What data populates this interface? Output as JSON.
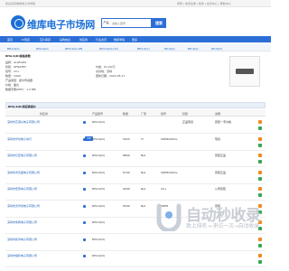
{
  "topbar": {
    "left_text": "欢迎来到维库电子市场网",
    "right_links": [
      "登录",
      "免费注册",
      "我的",
      "会员中心",
      "帮助中心"
    ]
  },
  "header": {
    "logo_text": "维库电子市场网",
    "search_type": "产品",
    "search_placeholder": "请输入型号",
    "search_button": "搜索"
  },
  "navbar": {
    "items": [
      "首页",
      "IC现货",
      "芯片库存",
      "采购信息",
      "供应商",
      "行业资讯",
      "维库学院",
      "更多"
    ]
  },
  "subnav": {
    "items": [
      "BHA-S(0)",
      "RHA-S(0)",
      "RHA-S(0)-ZN",
      "RHA-S(D)-LCC",
      "BHA-S(C)",
      "RH-S(0)",
      "BH-S(0)",
      "RH-S(D)"
    ]
  },
  "detail": {
    "title": "RHA-S(D)规格参数",
    "lines": [
      {
        "label": "品牌",
        "value": "ALLEGRO"
      },
      {
        "label": "封装",
        "value": "QFN/DFN"
      },
      {
        "label": "批号",
        "value": "22+"
      },
      {
        "label": "数量",
        "value": "1000"
      },
      {
        "label": "产品类型",
        "value": "霍尔传感器"
      },
      {
        "label": "价格",
        "value": "面议"
      },
      {
        "label": "数据手册(PDF)",
        "value": "1.2 MB"
      }
    ],
    "right_lines": [
      {
        "label": "价格",
        "value": "¥1.20/元"
      },
      {
        "label": "交货地",
        "value": "深圳"
      },
      {
        "label": "更新日期",
        "value": "2024-05-17"
      }
    ],
    "image_alt": "chip-image"
  },
  "table": {
    "title": "RHA-S(D)供应商报价",
    "headers": [
      "供应商",
      "产品型号",
      "数量",
      "厂家",
      "批号",
      "封装",
      "说明"
    ],
    "rows": [
      {
        "supplier": "深圳市芯源兴电子有限公司",
        "model": "RHA-S(D)",
        "qty": "",
        "brand": "",
        "batch": "",
        "package": "正品现货",
        "note": "原装一手价格",
        "tag": ""
      },
      {
        "supplier": "深圳市华创电子商行",
        "model": "RHA-S(D)",
        "qty": "5023",
        "brand": "TI",
        "batch": "SOP8/2022+",
        "package": "",
        "note": "现货",
        "tag": "VIP"
      },
      {
        "supplier": "深圳市亿宏电子有限公司",
        "model": "RHA-S(D)",
        "qty": "8800",
        "brand": "N/A",
        "batch": "",
        "package": "",
        "note": "原装正品",
        "tag": ""
      },
      {
        "supplier": "深圳市鸿天盛电子有限公司",
        "model": "RHA-S(D)",
        "qty": "6700",
        "brand": "N/A",
        "batch": "SOP8/2022+",
        "package": "",
        "note": "原装正品",
        "tag": ""
      },
      {
        "supplier": "深圳市宏伟电子有限公司",
        "model": "RHA-S(D)",
        "qty": "9000",
        "brand": "N/A",
        "batch": "22+",
        "package": "",
        "note": "公司原装",
        "tag": ""
      },
      {
        "supplier": "深圳市天华创电子有限公司",
        "model": "RHA-S(D)",
        "qty": "6500",
        "brand": "N/A",
        "batch": "SOP8",
        "package": "",
        "note": "原装",
        "tag": ""
      },
      {
        "supplier": "深圳市永辉电子有限公司",
        "model": "RHA-S(D)",
        "qty": "",
        "brand": "",
        "batch": "",
        "package": "",
        "note": "",
        "tag": ""
      },
      {
        "supplier": "深圳市凯鸿电子有限公司",
        "model": "RHA-S(D)",
        "qty": "",
        "brand": "",
        "batch": "",
        "package": "",
        "note": "",
        "tag": ""
      },
      {
        "supplier": "深圳市恒科电子有限公司",
        "model": "RHA-S(D)",
        "qty": "",
        "brand": "",
        "batch": "",
        "package": "",
        "note": "",
        "tag": ""
      }
    ]
  },
  "watermark": {
    "title": "自动秒收录",
    "subtitle": "致上排名 ←来访一次→自动收录"
  },
  "colors": {
    "brand": "#2b6fd6",
    "accent": "#f08a1c",
    "success": "#35a853"
  }
}
